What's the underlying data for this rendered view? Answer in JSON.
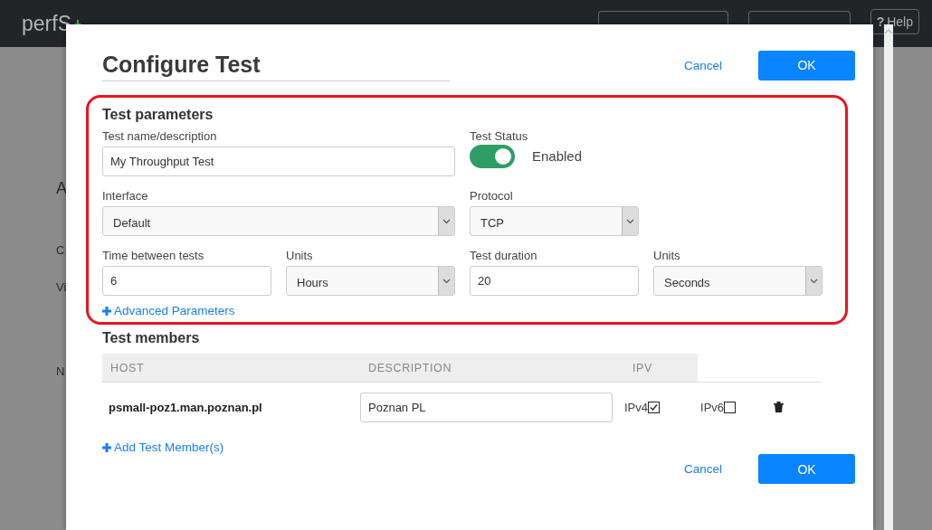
{
  "navbar": {
    "brand": "perfS",
    "help_button": {
      "glyph": "?",
      "label": "Help"
    }
  },
  "background_fragments": [
    "A",
    "C",
    "Vi",
    "N"
  ],
  "dialog": {
    "title": "Configure Test",
    "header_actions": {
      "cancel": "Cancel",
      "ok": "OK"
    },
    "parameters": {
      "heading": "Test parameters",
      "highlighted": true,
      "fields": [
        {
          "kind": "text",
          "label": "Test name/description",
          "value": "My Throughput Test"
        },
        {
          "kind": "toggle",
          "label": "Test Status",
          "on": true,
          "state_label": "Enabled"
        },
        {
          "kind": "select",
          "label": "Interface",
          "value": "Default"
        },
        {
          "kind": "select",
          "label": "Protocol",
          "value": "TCP"
        },
        {
          "kind": "text",
          "label": "Time between tests",
          "value": "6"
        },
        {
          "kind": "select",
          "label": "Units",
          "value": "Hours"
        },
        {
          "kind": "text",
          "label": "Test duration",
          "value": "20"
        },
        {
          "kind": "select",
          "label": "Units",
          "value": "Seconds"
        }
      ],
      "advanced_link": "Advanced Parameters"
    },
    "members": {
      "heading": "Test members",
      "columns": [
        "HOST",
        "DESCRIPTION",
        "IPV"
      ],
      "rows": [
        {
          "host": "psmall-poz1.man.poznan.pl",
          "description": "Poznan PL",
          "ip_options": [
            {
              "label": "IPv4",
              "checked": true
            },
            {
              "label": "IPv6",
              "checked": false
            }
          ]
        }
      ],
      "add_link": "Add Test Member(s)"
    },
    "footer_actions": {
      "cancel": "Cancel",
      "ok": "OK"
    }
  }
}
